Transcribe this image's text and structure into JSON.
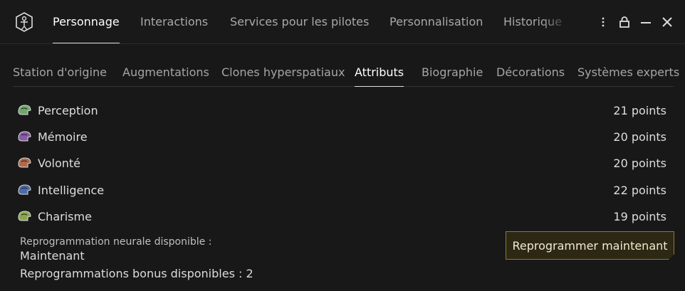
{
  "main_tabs": [
    {
      "label": "Personnage"
    },
    {
      "label": "Interactions"
    },
    {
      "label": "Services pour les pilotes"
    },
    {
      "label": "Personnalisation"
    },
    {
      "label": "Historique"
    }
  ],
  "sub_tabs": [
    {
      "label": "Station d'origine"
    },
    {
      "label": "Augmentations"
    },
    {
      "label": "Clones hyperspatiaux"
    },
    {
      "label": "Attributs"
    },
    {
      "label": "Biographie"
    },
    {
      "label": "Décorations"
    },
    {
      "label": "Systèmes experts"
    }
  ],
  "attributes": [
    {
      "name": "Perception",
      "value": "21 points",
      "icon": "perception-icon",
      "color": "#6fa86a"
    },
    {
      "name": "Mémoire",
      "value": "20 points",
      "icon": "memory-icon",
      "color": "#8a5aa8"
    },
    {
      "name": "Volonté",
      "value": "20 points",
      "icon": "willpower-icon",
      "color": "#b06a4a"
    },
    {
      "name": "Intelligence",
      "value": "22 points",
      "icon": "intelligence-icon",
      "color": "#4a6aa8"
    },
    {
      "name": "Charisme",
      "value": "19 points",
      "icon": "charisma-icon",
      "color": "#8aa84a"
    }
  ],
  "remap": {
    "label": "Reprogrammation neurale disponible :",
    "when": "Maintenant",
    "bonus": "Reprogrammations bonus disponibles : 2",
    "button": "Reprogrammer maintenant"
  },
  "colors": {
    "accent_button_border": "#8a7a3a",
    "background": "#181818"
  }
}
